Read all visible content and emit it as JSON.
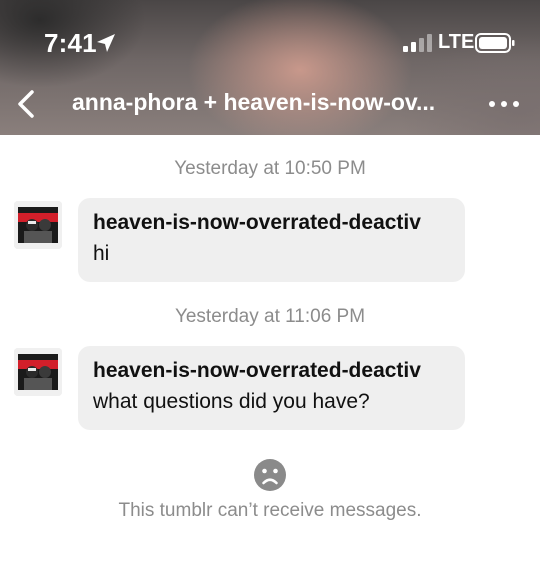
{
  "status_bar": {
    "time": "7:41",
    "network": "LTE",
    "icons": [
      "location-arrow-icon",
      "signal-icon",
      "battery-icon"
    ]
  },
  "nav": {
    "back_icon": "chevron-left-icon",
    "title": "anna-phora + heaven-is-now-ov...",
    "more_icon": "more-horizontal-icon"
  },
  "conversation": {
    "messages": [
      {
        "timestamp": "Yesterday at 10:50 PM",
        "sender": "heaven-is-now-overrated-deactiv",
        "text": "hi"
      },
      {
        "timestamp": "Yesterday at 11:06 PM",
        "sender": "heaven-is-now-overrated-deactiv",
        "text": "what questions did you have?"
      }
    ],
    "notice": {
      "icon": "sad-face-icon",
      "text": "This tumblr can’t receive messages."
    }
  },
  "colors": {
    "bubble": "#efefef",
    "muted_text": "#8c8c8c",
    "header_text": "#ffffff"
  }
}
